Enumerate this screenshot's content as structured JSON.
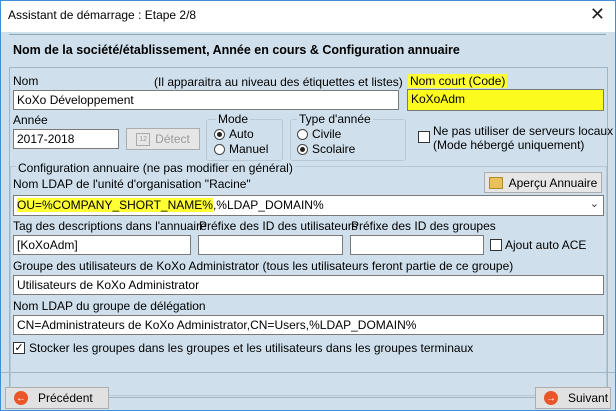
{
  "window": {
    "title": "Assistant de démarrage : Etape 2/8"
  },
  "header": {
    "title": "Nom de la société/établissement, Année en cours & Configuration annuaire"
  },
  "company": {
    "name_label": "Nom",
    "name_hint": "(Il apparaitra au  niveau des étiquettes et listes)",
    "name_value": "KoXo Développement",
    "short_label": "Nom court (Code)",
    "short_value": "KoXoAdm"
  },
  "year": {
    "label": "Année",
    "value": "2017-2018",
    "detect_label": "Détect"
  },
  "mode": {
    "label": "Mode",
    "options": [
      "Auto",
      "Manuel"
    ],
    "selected": "Auto"
  },
  "year_type": {
    "label": "Type d'année",
    "options": [
      "Civile",
      "Scolaire"
    ],
    "selected": "Scolaire"
  },
  "local_servers": {
    "label_line1": "Ne pas utiliser de serveurs locaux",
    "label_line2": "(Mode hébergé uniquement)",
    "checked": false
  },
  "directory": {
    "section_label": "Configuration annuaire (ne pas modifier en général)",
    "ldap_ou_label": "Nom LDAP de l'unité d'organisation \"Racine\"",
    "preview_label": "Aperçu Annuaire",
    "ldap_ou_value_highlight": "OU=%COMPANY_SHORT_NAME%",
    "ldap_ou_value_rest": ",%LDAP_DOMAIN%",
    "tag_label": "Tag des descriptions dans l'annuaire",
    "tag_value": "[KoXoAdm]",
    "user_prefix_label": "Préfixe des ID des utilisateurs",
    "user_prefix_value": "",
    "group_prefix_label": "Préfixe des ID des groupes",
    "group_prefix_value": "",
    "auto_ace_label": "Ajout auto ACE",
    "auto_ace_checked": false,
    "users_group_label": "Groupe des utilisateurs de KoXo Administrator (tous les utilisateurs feront partie de ce groupe)",
    "users_group_value": "Utilisateurs de KoXo Administrator",
    "delegation_label": "Nom LDAP du groupe de délégation",
    "delegation_value": "CN=Administrateurs de KoXo Administrator,CN=Users,%LDAP_DOMAIN%",
    "store_groups_label": "Stocker les groupes dans les groupes et les utilisateurs dans les groupes terminaux",
    "store_groups_checked": true
  },
  "nav": {
    "prev_label": "Précédent",
    "next_label": "Suivant"
  }
}
